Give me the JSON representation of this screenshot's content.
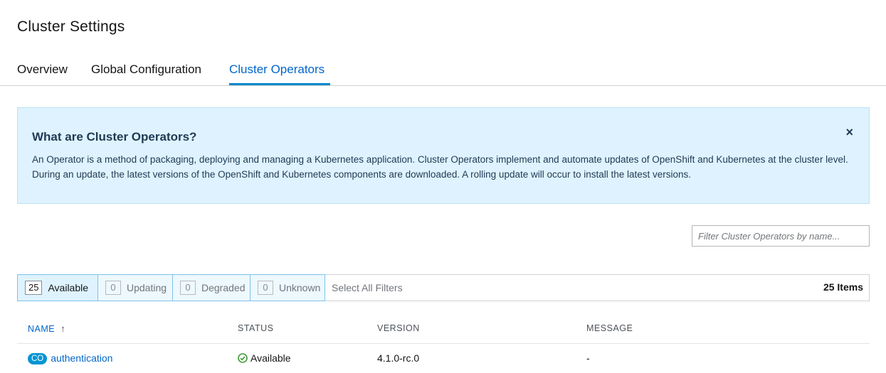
{
  "page": {
    "title": "Cluster Settings"
  },
  "tabs": [
    {
      "label": "Overview"
    },
    {
      "label": "Global Configuration"
    },
    {
      "label": "Cluster Operators"
    }
  ],
  "alert": {
    "title": "What are Cluster Operators?",
    "body": "An Operator is a method of packaging, deploying and managing a Kubernetes application. Cluster Operators implement and automate updates of OpenShift and Kubernetes at the cluster level. During an update, the latest versions of the OpenShift and Kubernetes components are downloaded. A rolling update will occur to install the latest versions.",
    "close_icon": "×"
  },
  "filter": {
    "placeholder": "Filter Cluster Operators by name..."
  },
  "row_filters": {
    "items": [
      {
        "count": "25",
        "label": "Available"
      },
      {
        "count": "0",
        "label": "Updating"
      },
      {
        "count": "0",
        "label": "Degraded"
      },
      {
        "count": "0",
        "label": "Unknown"
      }
    ],
    "select_all": "Select All Filters",
    "items_count": "25 Items"
  },
  "table": {
    "columns": [
      "NAME",
      "STATUS",
      "VERSION",
      "MESSAGE"
    ],
    "sort_icon": "↑",
    "rows": [
      {
        "badge": "CO",
        "name": "authentication",
        "status": "Available",
        "version": "4.1.0-rc.0",
        "message": "-"
      }
    ]
  },
  "colors": {
    "accent": "#0066cc",
    "alert_bg": "#def3ff",
    "success": "#3f9c35",
    "badge": "#0095d3"
  }
}
